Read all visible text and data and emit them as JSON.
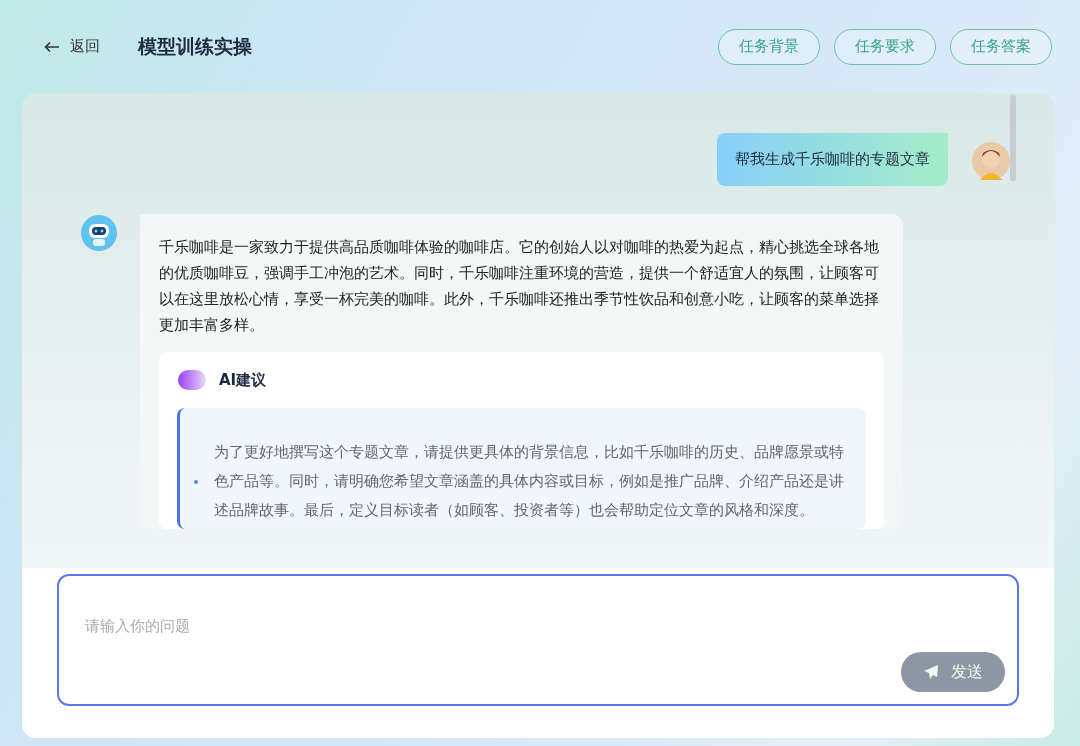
{
  "header": {
    "back": "返回",
    "title": "模型训练实操",
    "buttons": [
      "任务背景",
      "任务要求",
      "任务答案"
    ]
  },
  "messages": [
    {
      "kind": "user",
      "text": "帮我生成千乐咖啡的专题文章"
    },
    {
      "kind": "bot",
      "text": "千乐咖啡是一家致力于提供高品质咖啡体验的咖啡店。它的创始人以对咖啡的热爱为起点，精心挑选全球各地的优质咖啡豆，强调手工冲泡的艺术。同时，千乐咖啡注重环境的营造，提供一个舒适宜人的氛围，让顾客可以在这里放松心情，享受一杯完美的咖啡。此外，千乐咖啡还推出季节性饮品和创意小吃，让顾客的菜单选择更加丰富多样。",
      "suggestion": {
        "title": "AI建议",
        "items": [
          "为了更好地撰写这个专题文章，请提供更具体的背景信息，比如千乐咖啡的历史、品牌愿景或特色产品等。同时，请明确您希望文章涵盖的具体内容或目标，例如是推广品牌、介绍产品还是讲述品牌故事。最后，定义目标读者（如顾客、投资者等）也会帮助定位文章的风格和深度。"
        ]
      }
    }
  ],
  "input": {
    "placeholder": "请输入你的问题",
    "send": {
      "label": "发送",
      "disabled": true
    }
  }
}
